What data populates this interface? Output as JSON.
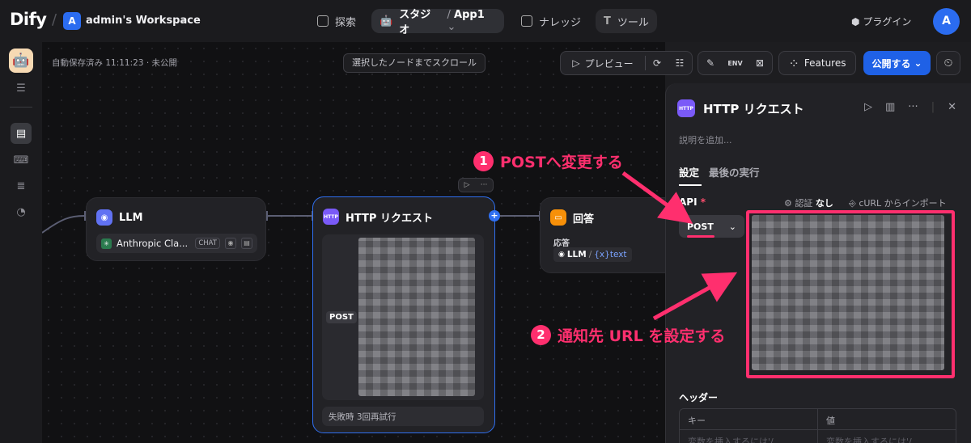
{
  "topbar": {
    "logo": "Dify",
    "workspace_initial": "A",
    "workspace_name": "admin's Workspace",
    "nav": {
      "explore": "探索",
      "studio": "スタジオ",
      "app": "App1",
      "knowledge": "ナレッジ",
      "tools": "ツール"
    },
    "plugins": "プラグイン",
    "user_initial": "A"
  },
  "canvas": {
    "autosave": "自動保存済み 11:11:23 · 未公開",
    "scroll_to_node": "選択したノードまでスクロール"
  },
  "toolbar": {
    "preview": "プレビュー",
    "features": "Features",
    "publish": "公開する"
  },
  "nodes": {
    "llm": {
      "title": "LLM",
      "model": "Anthropic Cla...",
      "mode_chip": "CHAT"
    },
    "http": {
      "title": "HTTP リクエスト",
      "icon_label": "HTTP",
      "method": "POST",
      "retry": "失敗時 3回再試行"
    },
    "answer": {
      "title": "回答",
      "label": "応答",
      "var_source": "LLM",
      "var_sep": "/",
      "var_name": "{x}text"
    }
  },
  "panel": {
    "title": "HTTP リクエスト",
    "icon_label": "HTTP",
    "description_placeholder": "説明を追加...",
    "tabs": [
      "設定",
      "最後の実行"
    ],
    "api_label": "API",
    "required_mark": "*",
    "auth_label": "認証",
    "auth_value": "なし",
    "curl_import": "cURL からインポート",
    "method": "POST",
    "headers_label": "ヘッダー",
    "kv_key": "キー",
    "kv_value": "値",
    "kv_placeholder": "変数を挿入するには'/"
  },
  "annotations": {
    "step1_num": "1",
    "step1_text": "POSTへ変更する",
    "step2_num": "2",
    "step2_text": "通知先 URL を設定する"
  },
  "colors": {
    "accent": "#ff2f6e",
    "primary": "#1f61e6",
    "llm_icon": "#6172f3",
    "http_icon": "#7a5af8",
    "answer_icon": "#f79009"
  }
}
